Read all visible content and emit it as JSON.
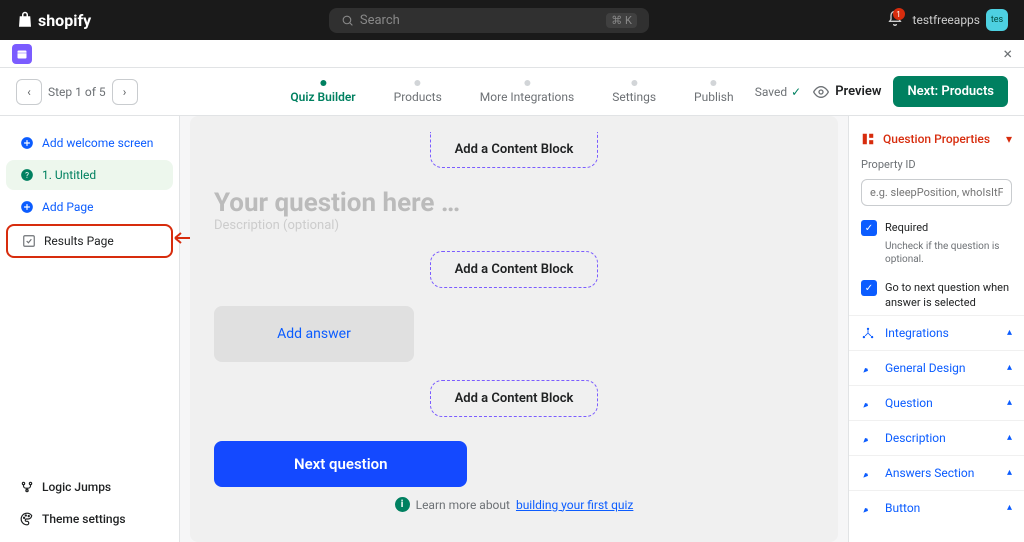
{
  "top": {
    "brand": "shopify",
    "search_placeholder": "Search",
    "kbd": "⌘ K",
    "notif_count": "1",
    "username": "testfreeapps",
    "avatar_text": "tes"
  },
  "stepbar": {
    "step_label": "Step 1 of 5",
    "tabs": [
      "Quiz Builder",
      "Products",
      "More Integrations",
      "Settings",
      "Publish"
    ],
    "saved": "Saved",
    "preview": "Preview",
    "next_btn": "Next: Products"
  },
  "sidebar": {
    "welcome": "Add welcome screen",
    "untitled": "1. Untitled",
    "add_page": "Add Page",
    "results": "Results Page",
    "logic_jumps": "Logic Jumps",
    "theme": "Theme settings"
  },
  "canvas": {
    "question_placeholder": "Your question here …",
    "description_placeholder": "Description (optional)",
    "content_block": "Add a Content Block",
    "add_answer": "Add answer",
    "next_question": "Next question",
    "learn_prefix": "Learn more about ",
    "learn_link": "building your first quiz"
  },
  "panel": {
    "header": "Question Properties",
    "property_id_label": "Property ID",
    "property_id_placeholder": "e.g. sleepPosition, whoIsItFor",
    "required_label": "Required",
    "required_sub": "Uncheck if the question is optional.",
    "goto_label": "Go to next question when answer is selected",
    "accordions": [
      "Integrations",
      "General Design",
      "Question",
      "Description",
      "Answers Section",
      "Button"
    ]
  }
}
